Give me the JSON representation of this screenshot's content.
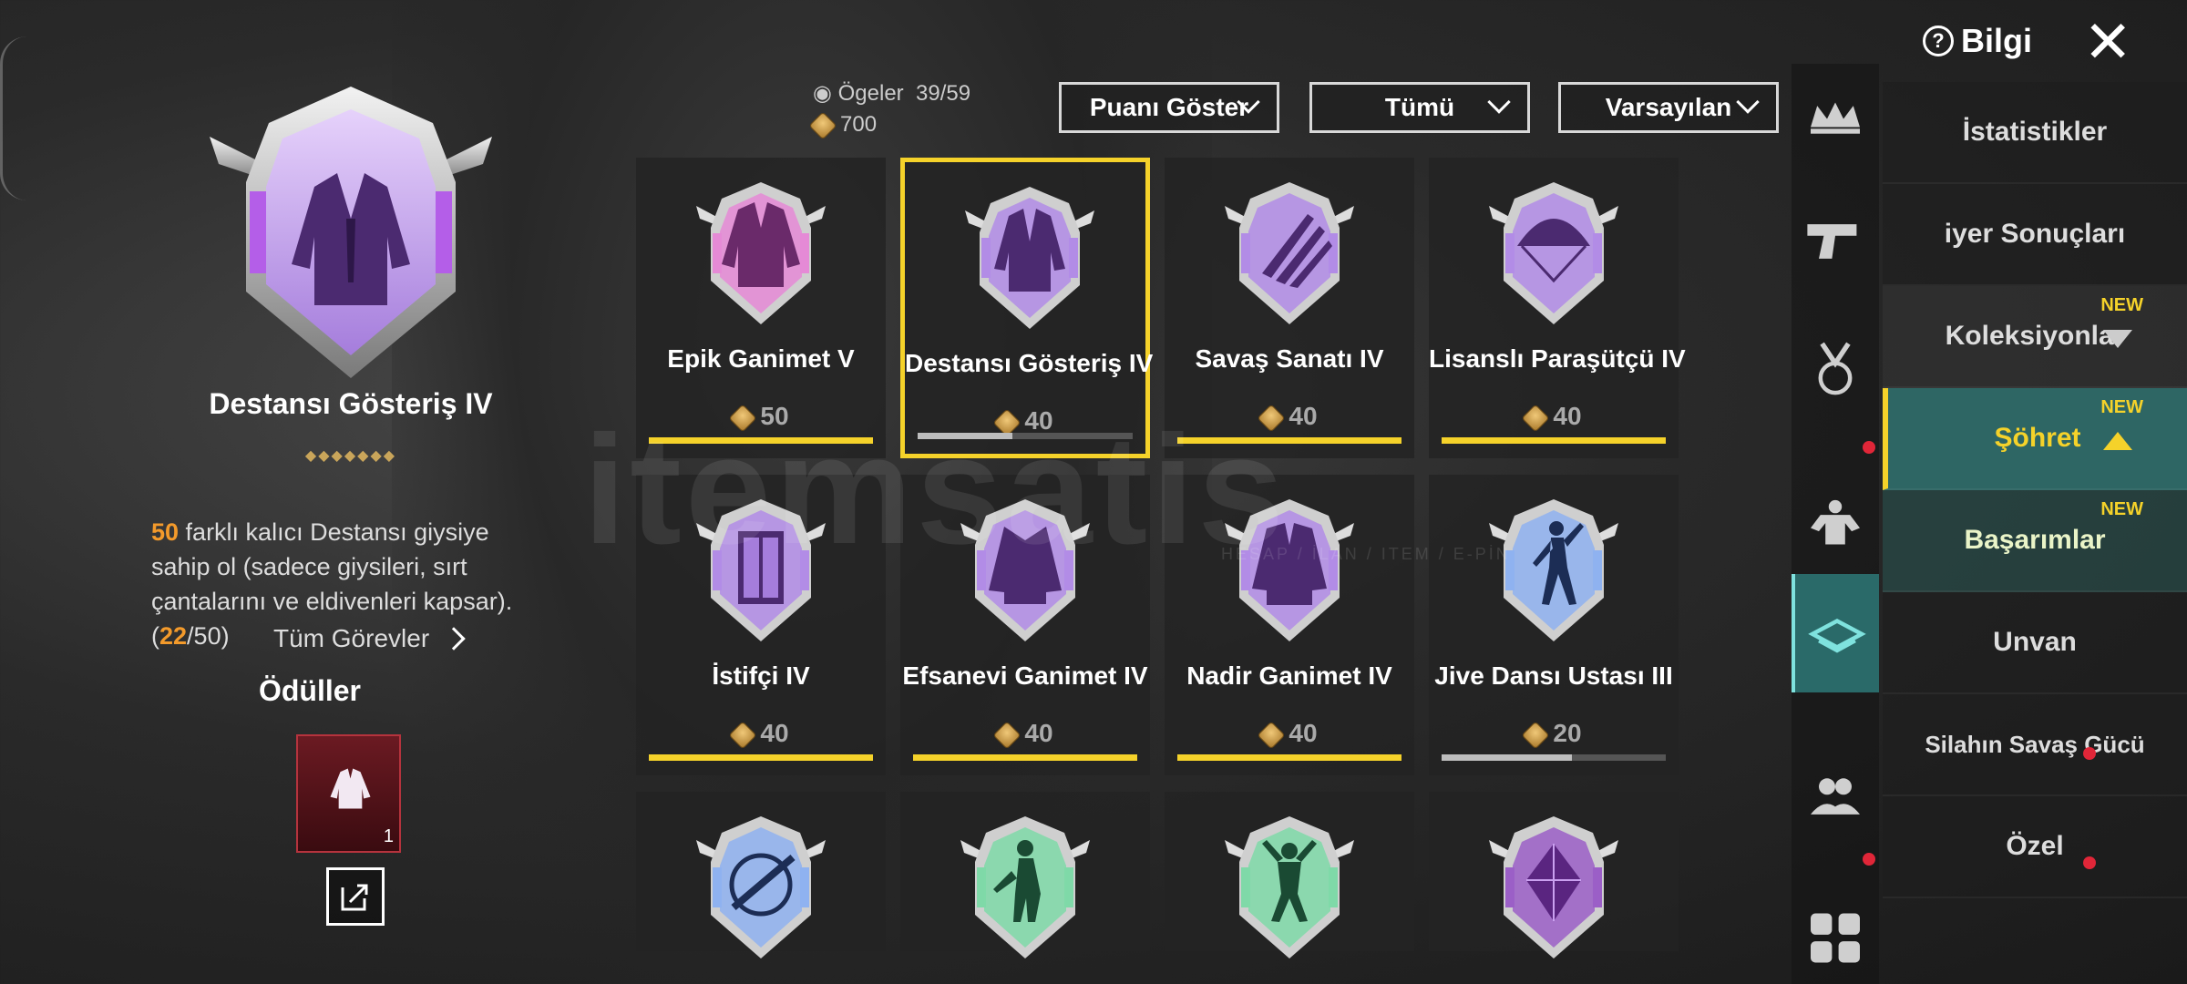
{
  "header": {
    "info_label": "Bilgi",
    "close_label": "✕"
  },
  "counts": {
    "items_label": "Ögeler",
    "items_value": "39/59",
    "points_value": "700"
  },
  "filters": [
    {
      "label": "Puanı Göster"
    },
    {
      "label": "Tümü"
    },
    {
      "label": "Varsayılan"
    }
  ],
  "detail": {
    "title": "Destansı Gösteriş IV",
    "desc_prefix": "50",
    "desc_middle": " farklı kalıcı Destansı giysiye sahip ol (sadece giysileri, sırt çantalarını ve eldivenleri kapsar). (",
    "desc_progress": "22",
    "desc_suffix": "/50)",
    "all_tasks_label": "Tüm Görevler",
    "rewards_label": "Ödüller",
    "reward_qty": "1"
  },
  "cards": [
    {
      "name": "Epik Ganimet V",
      "points": "50",
      "progress": 1.0,
      "icon": "jacket-icon",
      "color": "#e58ad6"
    },
    {
      "name": "Destansı Gösteriş IV",
      "points": "40",
      "progress": 0.44,
      "icon": "suit-icon",
      "color": "#b28ce6",
      "selected": true
    },
    {
      "name": "Savaş Sanatı IV",
      "points": "40",
      "progress": 1.0,
      "icon": "claw-icon",
      "color": "#b28ce6"
    },
    {
      "name": "Lisanslı Paraşütçü IV",
      "points": "40",
      "progress": 1.0,
      "icon": "parachute-icon",
      "color": "#b28ce6"
    },
    {
      "name": "İstifçi IV",
      "points": "40",
      "progress": 1.0,
      "icon": "locker-icon",
      "color": "#b28ce6"
    },
    {
      "name": "Efsanevi Ganimet IV",
      "points": "40",
      "progress": 1.0,
      "icon": "robe-icon",
      "color": "#b28ce6"
    },
    {
      "name": "Nadir Ganimet IV",
      "points": "40",
      "progress": 1.0,
      "icon": "coat-icon",
      "color": "#b28ce6"
    },
    {
      "name": "Jive Dansı Ustası III",
      "points": "20",
      "progress": 0.58,
      "icon": "dancer-icon",
      "color": "#8fb2f0"
    },
    {
      "name": "",
      "points": "",
      "progress": null,
      "icon": "crosshair-icon",
      "color": "#8fb2f0"
    },
    {
      "name": "",
      "points": "",
      "progress": null,
      "icon": "fighter-icon",
      "color": "#7fd9a8"
    },
    {
      "name": "",
      "points": "",
      "progress": null,
      "icon": "jumper-icon",
      "color": "#7fd9a8"
    },
    {
      "name": "",
      "points": "",
      "progress": null,
      "icon": "gem-icon",
      "color": "#9b5fc7"
    }
  ],
  "side_menu": [
    {
      "label": "İstatistikler"
    },
    {
      "label": "iyer Sonuçları"
    },
    {
      "label": "Koleksiyonlar",
      "new": "NEW",
      "arrow": "down"
    },
    {
      "label": "Şöhret",
      "new": "NEW",
      "arrow": "up",
      "active": true
    },
    {
      "label": "Başarımlar",
      "new": "NEW",
      "sub": true
    },
    {
      "label": "Unvan"
    },
    {
      "label": "Silahın Savaş Gücü"
    },
    {
      "label": "Özel"
    }
  ],
  "icon_column": [
    "crown-icon",
    "pistol-icon",
    "medal-icon",
    "muscle-icon",
    "achievement-icon",
    "friends-icon",
    "grid-icon"
  ],
  "watermark": {
    "brand": "itemsatis",
    "sub": "HESAP / İLAN / ITEM / E-PİN"
  }
}
